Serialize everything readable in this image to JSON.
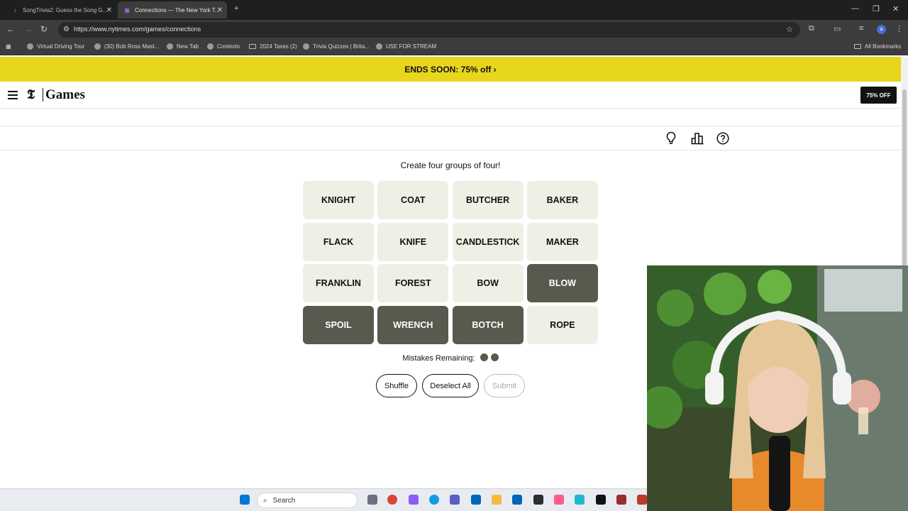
{
  "browser": {
    "tabs": [
      {
        "title": "SongTrivia2: Guess the Song G...",
        "active": false
      },
      {
        "title": "Connections — The New York T...",
        "active": true
      }
    ],
    "url": "https://www.nytimes.com/games/connections",
    "bookmarks": [
      "Virtual Driving Tour",
      "(30) Bob Ross Mast...",
      "New Tab",
      "Contexto",
      "2024 Taxes (2)",
      "Trivia Quizzes | Brita...",
      "USE FOR STREAM"
    ],
    "all_bookmarks": "All Bookmarks"
  },
  "promo": {
    "text": "ENDS SOON:  75% off ›"
  },
  "header": {
    "logo_t": "𝕿",
    "logo_games": "Games",
    "offer_button": "75% OFF"
  },
  "game": {
    "instruction": "Create four groups of four!",
    "tiles": [
      {
        "word": "KNIGHT",
        "selected": false
      },
      {
        "word": "COAT",
        "selected": false
      },
      {
        "word": "BUTCHER",
        "selected": false
      },
      {
        "word": "BAKER",
        "selected": false
      },
      {
        "word": "FLACK",
        "selected": false
      },
      {
        "word": "KNIFE",
        "selected": false
      },
      {
        "word": "CANDLESTICK",
        "selected": false
      },
      {
        "word": "MAKER",
        "selected": false
      },
      {
        "word": "FRANKLIN",
        "selected": false
      },
      {
        "word": "FOREST",
        "selected": false
      },
      {
        "word": "BOW",
        "selected": false
      },
      {
        "word": "BLOW",
        "selected": true
      },
      {
        "word": "SPOIL",
        "selected": true
      },
      {
        "word": "WRENCH",
        "selected": true
      },
      {
        "word": "BOTCH",
        "selected": true
      },
      {
        "word": "ROPE",
        "selected": false
      }
    ],
    "mistakes_label": "Mistakes Remaining:",
    "mistakes_remaining": 2,
    "buttons": {
      "shuffle": "Shuffle",
      "deselect": "Deselect All",
      "submit": "Submit"
    }
  },
  "taskbar": {
    "search": "Search"
  },
  "colors": {
    "promo": "#e8d51d",
    "tile": "#efefe6",
    "tile_selected": "#5a594e"
  }
}
